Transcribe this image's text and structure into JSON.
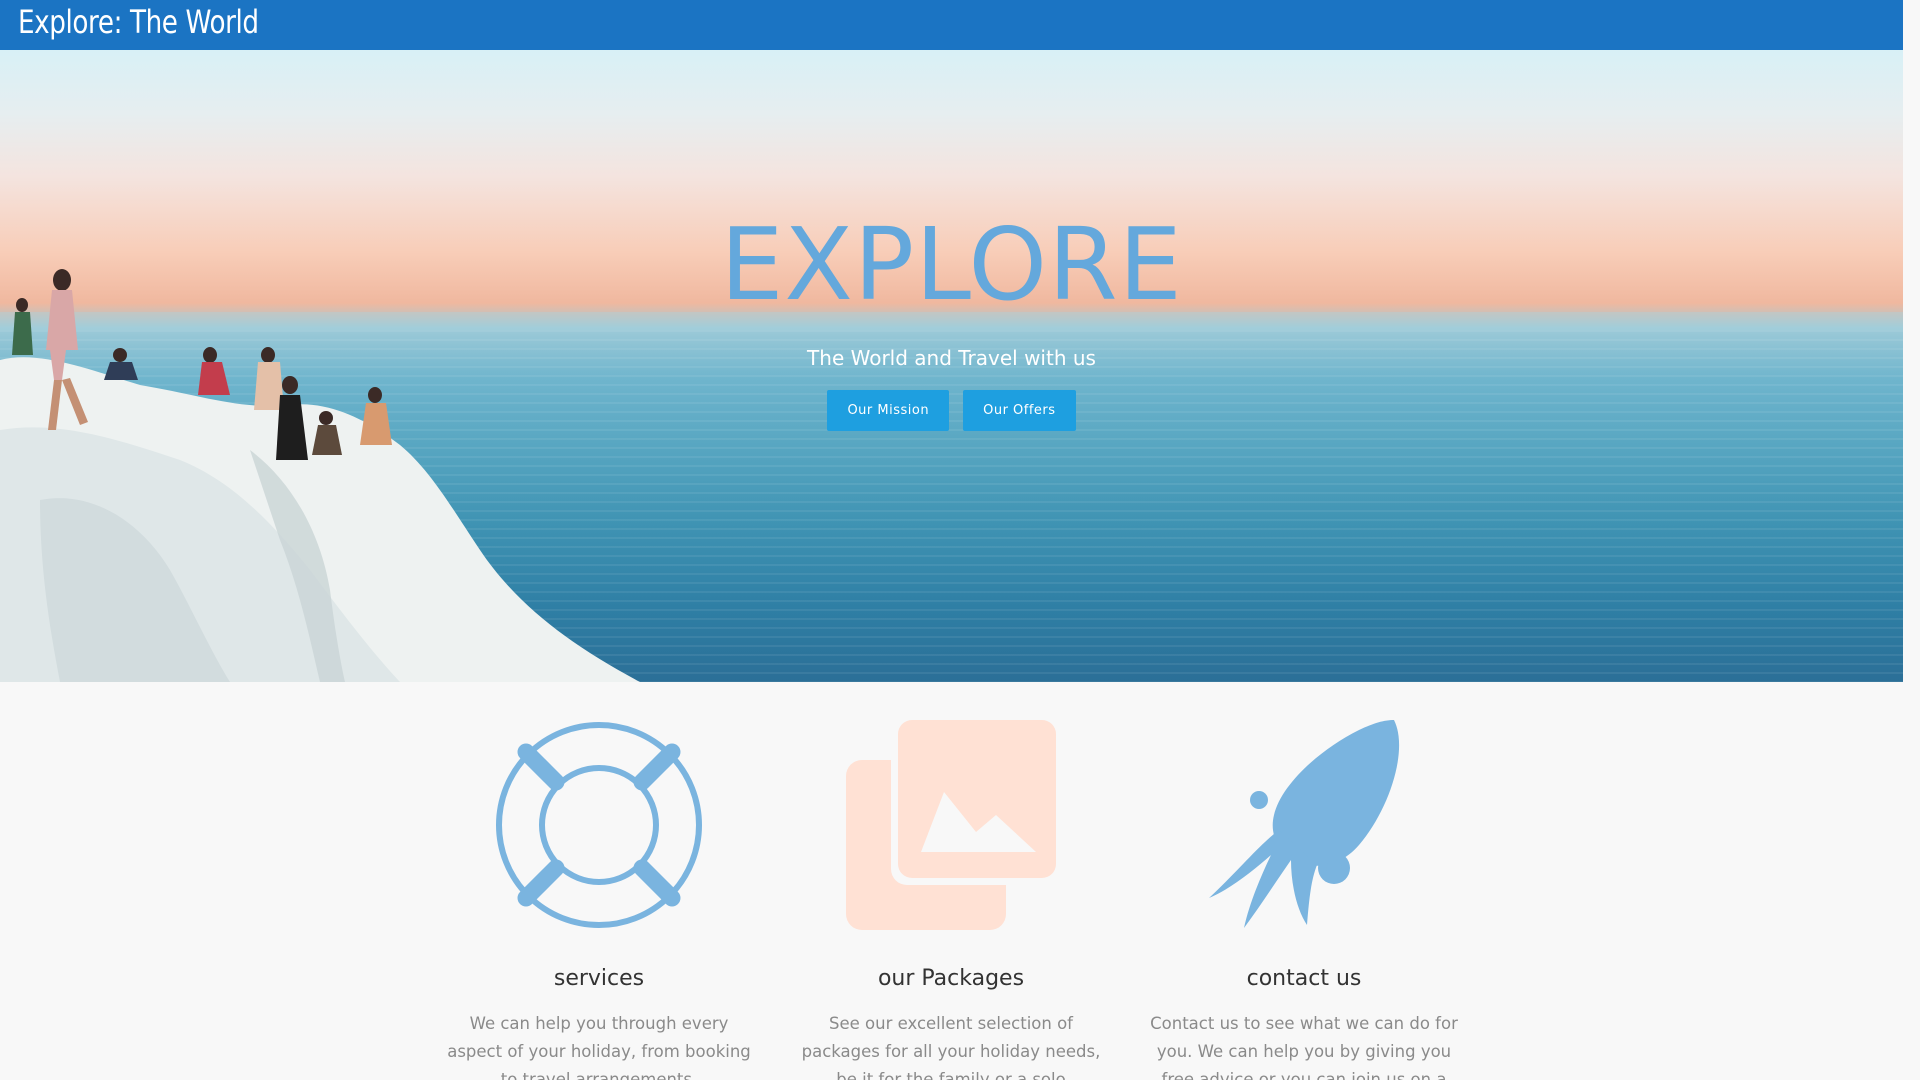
{
  "nav": {
    "brand": "Explore: The World"
  },
  "hero": {
    "title": "EXPLORE",
    "subtitle": "The World and Travel with us",
    "buttons": [
      {
        "label": "Our Mission"
      },
      {
        "label": "Our Offers"
      }
    ]
  },
  "features": [
    {
      "icon": "life-ring-icon",
      "icon_color": "#7ab4df",
      "title": "services",
      "text": "We can help you through every aspect of your holiday, from booking to travel arrangements."
    },
    {
      "icon": "images-icon",
      "icon_color": "#ffe1d4",
      "title": "our Packages",
      "text": "See our excellent selection of packages for all your holiday needs, be it for the family or a solo adventure, maybe even a trip with"
    },
    {
      "icon": "squid-icon",
      "icon_color": "#7ab4df",
      "title": "contact us",
      "text": "Contact us to see what we can do for you. We can help you by giving you free advice or you can join us on a retreat"
    }
  ],
  "colors": {
    "nav_bg": "#1b74c3",
    "hero_title": "#64a8dc",
    "button_bg": "#1e9fe0"
  }
}
